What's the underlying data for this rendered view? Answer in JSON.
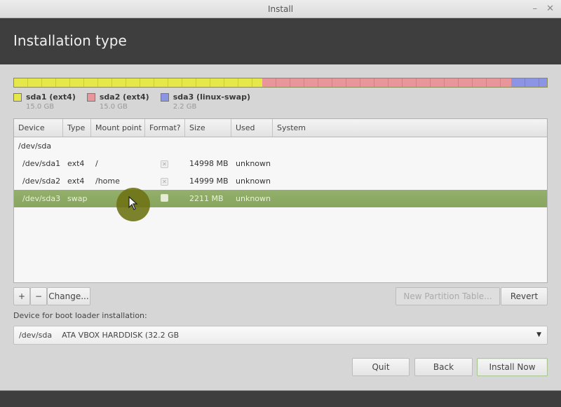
{
  "window": {
    "title": "Install",
    "minimize_glyph": "–",
    "close_glyph": "✕"
  },
  "header": {
    "title": "Installation type"
  },
  "partition_bar": [
    {
      "name": "sda1 (ext4)",
      "size": "15.0 GB",
      "fraction": 0.4663,
      "color": "#e6e84a"
    },
    {
      "name": "sda2 (ext4)",
      "size": "15.0 GB",
      "fraction": 0.4663,
      "color": "#e8969a"
    },
    {
      "name": "sda3 (linux-swap)",
      "size": "2.2 GB",
      "fraction": 0.0674,
      "color": "#8c94e4"
    }
  ],
  "table": {
    "columns": [
      "Device",
      "Type",
      "Mount point",
      "Format?",
      "Size",
      "Used",
      "System"
    ],
    "rows": [
      {
        "device": "/dev/sda",
        "type": "",
        "mount": "",
        "format": null,
        "size": "",
        "used": "",
        "system": "",
        "selected": false
      },
      {
        "device": "/dev/sda1",
        "type": "ext4",
        "mount": "/",
        "format": true,
        "size": "14998 MB",
        "used": "unknown",
        "system": "",
        "selected": false
      },
      {
        "device": "/dev/sda2",
        "type": "ext4",
        "mount": "/home",
        "format": true,
        "size": "14999 MB",
        "used": "unknown",
        "system": "",
        "selected": false
      },
      {
        "device": "/dev/sda3",
        "type": "swap",
        "mount": "",
        "format": false,
        "size": "2211 MB",
        "used": "unknown",
        "system": "",
        "selected": true
      }
    ]
  },
  "toolbar": {
    "add_label": "+",
    "remove_label": "−",
    "change_label": "Change...",
    "new_table_label": "New Partition Table...",
    "revert_label": "Revert"
  },
  "bootloader": {
    "label": "Device for boot loader installation:",
    "value": "/dev/sda    ATA VBOX HARDDISK (32.2 GB",
    "arrow": "▼"
  },
  "buttons": {
    "quit": "Quit",
    "back": "Back",
    "install": "Install Now"
  }
}
